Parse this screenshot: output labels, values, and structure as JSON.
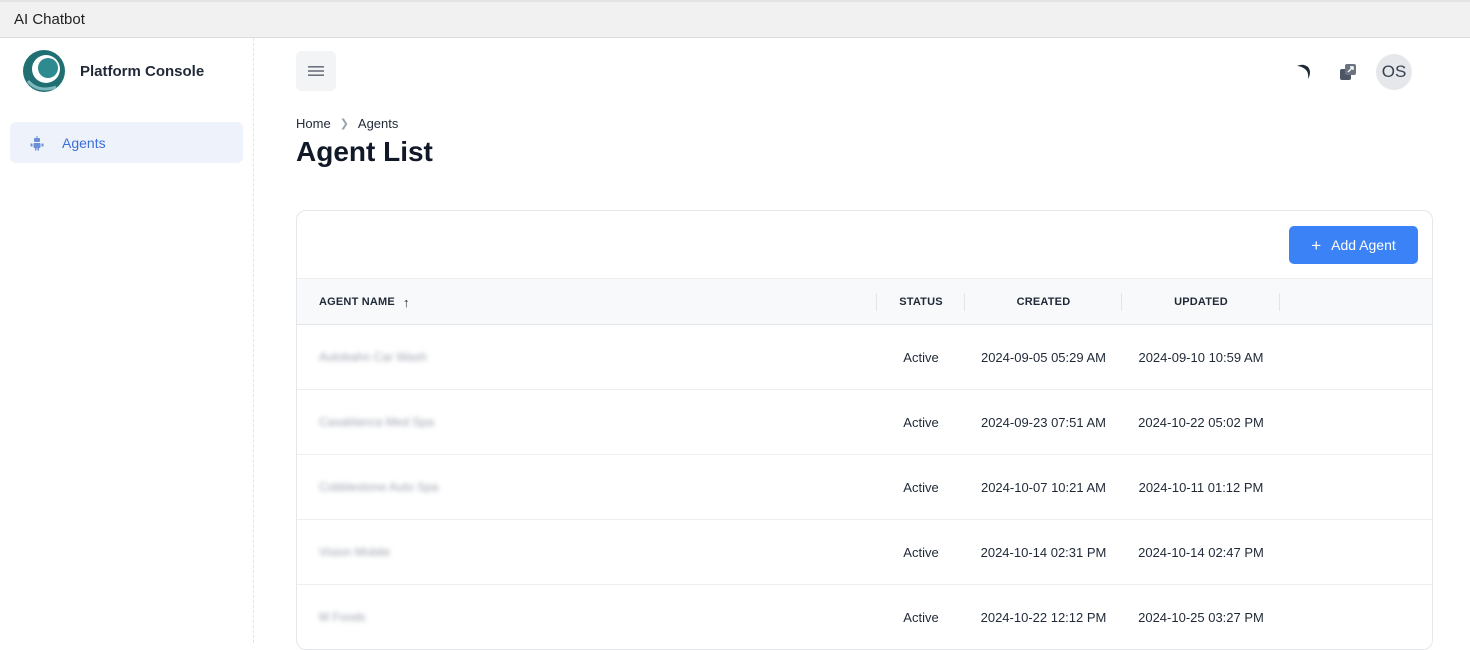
{
  "window": {
    "title": "AI Chatbot"
  },
  "sidebar": {
    "brand": "Platform Console",
    "items": [
      {
        "label": "Agents",
        "icon": "robot-icon",
        "active": true
      }
    ]
  },
  "header": {
    "menu_icon": "hamburger-icon",
    "icons": [
      "moon-icon",
      "expand-icon"
    ],
    "avatar_initials": "OS"
  },
  "breadcrumb": {
    "home": "Home",
    "current": "Agents"
  },
  "page": {
    "title": "Agent List"
  },
  "toolbar": {
    "add_label": "Add Agent"
  },
  "table": {
    "columns": {
      "name": "AGENT NAME",
      "status": "STATUS",
      "created": "CREATED",
      "updated": "UPDATED"
    },
    "sort": {
      "column": "name",
      "direction": "asc"
    },
    "rows": [
      {
        "name": "Autobahn Car Wash",
        "status": "Active",
        "created": "2024-09-05 05:29 AM",
        "updated": "2024-09-10 10:59 AM"
      },
      {
        "name": "Casablanca Med Spa",
        "status": "Active",
        "created": "2024-09-23 07:51 AM",
        "updated": "2024-10-22 05:02 PM"
      },
      {
        "name": "Cobblestone Auto Spa",
        "status": "Active",
        "created": "2024-10-07 10:21 AM",
        "updated": "2024-10-11 01:12 PM"
      },
      {
        "name": "Vision Mobile",
        "status": "Active",
        "created": "2024-10-14 02:31 PM",
        "updated": "2024-10-14 02:47 PM"
      },
      {
        "name": "M Foods",
        "status": "Active",
        "created": "2024-10-22 12:12 PM",
        "updated": "2024-10-25 03:27 PM"
      }
    ]
  },
  "colors": {
    "accent": "#3b82f6",
    "nav_active_bg": "#eef2fb",
    "nav_active_text": "#3b6fd9",
    "logo": "#1f6f73"
  }
}
